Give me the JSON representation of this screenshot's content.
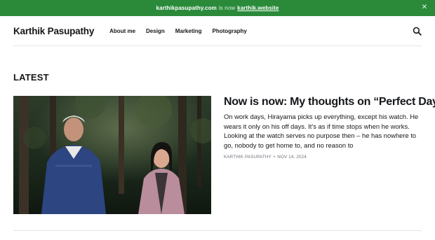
{
  "banner": {
    "old_domain": "karthikpasupathy.com",
    "connector": "is now",
    "new_domain": "karthik.website",
    "close_icon": "close-icon",
    "background": "#2a8a3a"
  },
  "header": {
    "logo": "Karthik Pasupathy",
    "nav": [
      "About me",
      "Design",
      "Marketing",
      "Photography"
    ],
    "search_icon": "search-icon"
  },
  "section": {
    "title": "LATEST"
  },
  "post": {
    "title": "Now is now: My thoughts on “Perfect Days”",
    "excerpt": "On work days, Hirayama picks up everything, except his watch. He wears it only on his off days. It's as if time stops when he works. Looking at the watch serves no purpose then – he has nowhere to go, nobody to get home to, and no reason to",
    "author": "Karthik Pasupathy",
    "separator": "•",
    "date": "Nov 14, 2024"
  }
}
